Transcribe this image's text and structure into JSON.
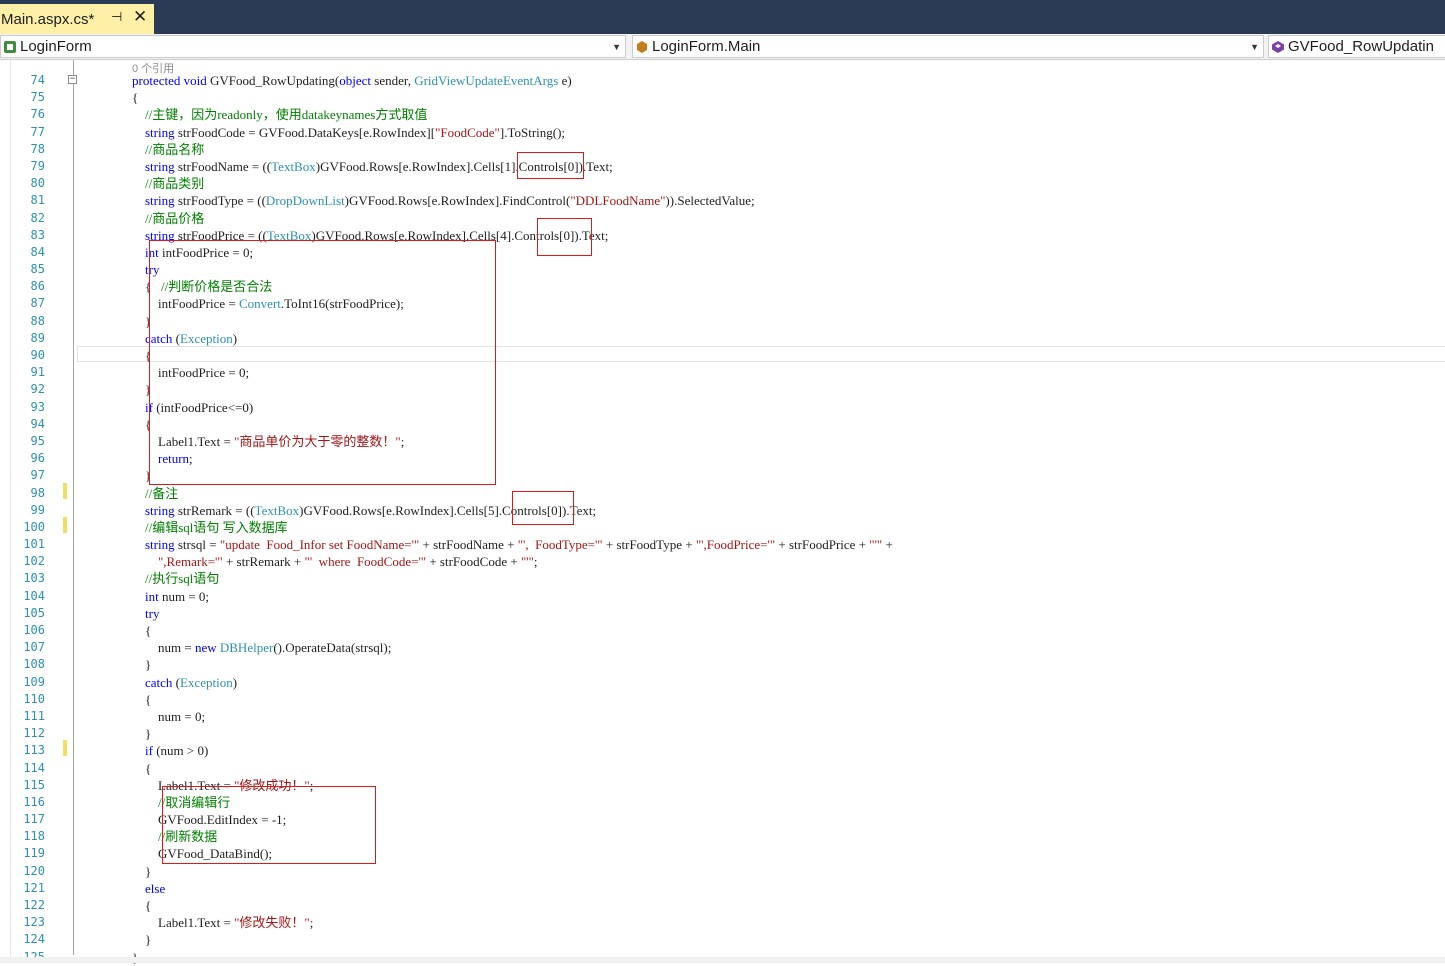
{
  "doc_tab": {
    "title": "Main.aspx.cs*",
    "pin": "⊣",
    "close": "✕"
  },
  "nav": {
    "project": "LoginForm",
    "class": "LoginForm.Main",
    "member": "GVFood_RowUpdatin"
  },
  "codelens": "0 个引用",
  "editor": {
    "lines": [
      {
        "n": "74",
        "t": [
          [
            "kw",
            "protected void "
          ],
          [
            "",
            "GVFood_RowUpdating("
          ],
          [
            "kw",
            "object"
          ],
          [
            "",
            " sender, "
          ],
          [
            "ty",
            "GridViewUpdateEventArgs"
          ],
          [
            "",
            " e)"
          ]
        ]
      },
      {
        "n": "75",
        "t": [
          [
            "",
            "{"
          ]
        ]
      },
      {
        "n": "76",
        "t": [
          [
            "",
            "    "
          ],
          [
            "cm",
            "//主键，因为readonly，使用datakeynames方式取值"
          ]
        ]
      },
      {
        "n": "77",
        "t": [
          [
            "",
            "    "
          ],
          [
            "kw",
            "string"
          ],
          [
            "",
            " strFoodCode = GVFood.DataKeys[e.RowIndex]["
          ],
          [
            "st",
            "\"FoodCode\""
          ],
          [
            "",
            "].ToString();"
          ]
        ]
      },
      {
        "n": "78",
        "t": [
          [
            "",
            "    "
          ],
          [
            "cm",
            "//商品名称"
          ]
        ]
      },
      {
        "n": "79",
        "t": [
          [
            "",
            "    "
          ],
          [
            "kw",
            "string"
          ],
          [
            "",
            " strFoodName = (("
          ],
          [
            "ty",
            "TextBox"
          ],
          [
            "",
            ")GVFood.Rows[e.RowIndex].Cells[1].Controls[0]).Text;"
          ]
        ]
      },
      {
        "n": "80",
        "t": [
          [
            "",
            "    "
          ],
          [
            "cm",
            "//商品类别"
          ]
        ]
      },
      {
        "n": "81",
        "t": [
          [
            "",
            "    "
          ],
          [
            "kw",
            "string"
          ],
          [
            "",
            " strFoodType = (("
          ],
          [
            "ty",
            "DropDownList"
          ],
          [
            "",
            ")GVFood.Rows[e.RowIndex].FindControl("
          ],
          [
            "st",
            "\"DDLFoodName\""
          ],
          [
            "",
            "))"
          ],
          [
            "",
            ".SelectedValue;"
          ]
        ]
      },
      {
        "n": "82",
        "t": [
          [
            "",
            "    "
          ],
          [
            "cm",
            "//商品价格"
          ]
        ]
      },
      {
        "n": "83",
        "t": [
          [
            "",
            "    "
          ],
          [
            "kw",
            "string"
          ],
          [
            "",
            " strFoodPrice = (("
          ],
          [
            "ty",
            "TextBox"
          ],
          [
            "",
            ")GVFood.Rows[e.RowIndex].Cells[4].Controls[0]).Text;"
          ]
        ]
      },
      {
        "n": "84",
        "t": [
          [
            "",
            "    "
          ],
          [
            "kw",
            "int"
          ],
          [
            "",
            " intFoodPrice = 0;"
          ]
        ]
      },
      {
        "n": "85",
        "t": [
          [
            "",
            "    "
          ],
          [
            "kw",
            "try"
          ]
        ]
      },
      {
        "n": "86",
        "t": [
          [
            "",
            "    {   "
          ],
          [
            "cm",
            "//判断价格是否合法"
          ]
        ]
      },
      {
        "n": "87",
        "t": [
          [
            "",
            "        intFoodPrice = "
          ],
          [
            "ty",
            "Convert"
          ],
          [
            "",
            ".ToInt16(strFoodPrice);"
          ]
        ]
      },
      {
        "n": "88",
        "t": [
          [
            "",
            "    }"
          ]
        ]
      },
      {
        "n": "89",
        "t": [
          [
            "",
            "    "
          ],
          [
            "kw",
            "catch"
          ],
          [
            "",
            " ("
          ],
          [
            "ty",
            "Exception"
          ],
          [
            "",
            ")"
          ]
        ]
      },
      {
        "n": "90",
        "t": [
          [
            "",
            "    {"
          ]
        ]
      },
      {
        "n": "91",
        "t": [
          [
            "",
            "        intFoodPrice = 0;"
          ]
        ]
      },
      {
        "n": "92",
        "t": [
          [
            "",
            "    }"
          ]
        ]
      },
      {
        "n": "93",
        "t": [
          [
            "",
            "    "
          ],
          [
            "kw",
            "if"
          ],
          [
            "",
            " (intFoodPrice<=0)"
          ]
        ]
      },
      {
        "n": "94",
        "t": [
          [
            "",
            "    {"
          ]
        ]
      },
      {
        "n": "95",
        "t": [
          [
            "",
            "        Label1.Text = "
          ],
          [
            "st",
            "\"商品单价为大于零的整数！\""
          ],
          [
            "",
            ";"
          ]
        ]
      },
      {
        "n": "96",
        "t": [
          [
            "",
            "        "
          ],
          [
            "kw",
            "return"
          ],
          [
            "",
            ";"
          ]
        ]
      },
      {
        "n": "97",
        "t": [
          [
            "",
            "    }"
          ]
        ]
      },
      {
        "n": "98",
        "t": [
          [
            "",
            "    "
          ],
          [
            "cm",
            "//备注"
          ]
        ]
      },
      {
        "n": "99",
        "t": [
          [
            "",
            "    "
          ],
          [
            "kw",
            "string"
          ],
          [
            "",
            " strRemark = (("
          ],
          [
            "ty",
            "TextBox"
          ],
          [
            "",
            ")GVFood.Rows[e.RowIndex].Cells[5].Controls[0]).Text;"
          ]
        ]
      },
      {
        "n": "100",
        "t": [
          [
            "",
            "    "
          ],
          [
            "cm",
            "//编辑sql语句 写入数据库"
          ]
        ]
      },
      {
        "n": "101",
        "t": [
          [
            "",
            "    "
          ],
          [
            "kw",
            "string"
          ],
          [
            "",
            " strsql = "
          ],
          [
            "st",
            "\"update  Food_Infor set FoodName='\""
          ],
          [
            "",
            " + strFoodName + "
          ],
          [
            "st",
            "\"',  FoodType='\""
          ],
          [
            "",
            " + strFoodType + "
          ],
          [
            "st",
            "\"',FoodPrice='\""
          ],
          [
            "",
            " + strFoodPrice + "
          ],
          [
            "st",
            "\"'\""
          ],
          [
            "",
            " +"
          ]
        ]
      },
      {
        "n": "102",
        "t": [
          [
            "",
            "        "
          ],
          [
            "st",
            "\",Remark='\""
          ],
          [
            "",
            " + strRemark + "
          ],
          [
            "st",
            "\"'  where  FoodCode='\""
          ],
          [
            "",
            " + strFoodCode + "
          ],
          [
            "st",
            "\"'\""
          ],
          [
            "",
            ";"
          ]
        ]
      },
      {
        "n": "103",
        "t": [
          [
            "",
            "    "
          ],
          [
            "cm",
            "//执行sql语句"
          ]
        ]
      },
      {
        "n": "104",
        "t": [
          [
            "",
            "    "
          ],
          [
            "kw",
            "int"
          ],
          [
            "",
            " num = 0;"
          ]
        ]
      },
      {
        "n": "105",
        "t": [
          [
            "",
            "    "
          ],
          [
            "kw",
            "try"
          ]
        ]
      },
      {
        "n": "106",
        "t": [
          [
            "",
            "    {"
          ]
        ]
      },
      {
        "n": "107",
        "t": [
          [
            "",
            "        num = "
          ],
          [
            "kw",
            "new"
          ],
          [
            "",
            " "
          ],
          [
            "ty",
            "DBHelper"
          ],
          [
            "",
            "().OperateData(strsql);"
          ]
        ]
      },
      {
        "n": "108",
        "t": [
          [
            "",
            "    }"
          ]
        ]
      },
      {
        "n": "109",
        "t": [
          [
            "",
            "    "
          ],
          [
            "kw",
            "catch"
          ],
          [
            "",
            " ("
          ],
          [
            "ty",
            "Exception"
          ],
          [
            "",
            ")"
          ]
        ]
      },
      {
        "n": "110",
        "t": [
          [
            "",
            "    {"
          ]
        ]
      },
      {
        "n": "111",
        "t": [
          [
            "",
            "        num = 0;"
          ]
        ]
      },
      {
        "n": "112",
        "t": [
          [
            "",
            "    }"
          ]
        ]
      },
      {
        "n": "113",
        "t": [
          [
            "",
            "    "
          ],
          [
            "kw",
            "if"
          ],
          [
            "",
            " (num > 0)"
          ]
        ]
      },
      {
        "n": "114",
        "t": [
          [
            "",
            "    {"
          ]
        ]
      },
      {
        "n": "115",
        "t": [
          [
            "",
            "        Label1.Text = "
          ],
          [
            "st",
            "\"修改成功！\""
          ],
          [
            "",
            ";"
          ]
        ]
      },
      {
        "n": "116",
        "t": [
          [
            "",
            "        "
          ],
          [
            "cm",
            "//取消编辑行"
          ]
        ]
      },
      {
        "n": "117",
        "t": [
          [
            "",
            "        GVFood.EditIndex = -1;"
          ]
        ]
      },
      {
        "n": "118",
        "t": [
          [
            "",
            "        "
          ],
          [
            "cm",
            "//刷新数据"
          ]
        ]
      },
      {
        "n": "119",
        "t": [
          [
            "",
            "        GVFood_DataBind();"
          ]
        ]
      },
      {
        "n": "120",
        "t": [
          [
            "",
            "    }"
          ]
        ]
      },
      {
        "n": "121",
        "t": [
          [
            "",
            "    "
          ],
          [
            "kw",
            "else"
          ]
        ]
      },
      {
        "n": "122",
        "t": [
          [
            "",
            "    {"
          ]
        ]
      },
      {
        "n": "123",
        "t": [
          [
            "",
            "        Label1.Text = "
          ],
          [
            "st",
            "\"修改失败！\""
          ],
          [
            "",
            ";"
          ]
        ]
      },
      {
        "n": "124",
        "t": [
          [
            "",
            "    }"
          ]
        ]
      },
      {
        "n": "125",
        "t": [
          [
            "",
            "}"
          ]
        ]
      }
    ]
  }
}
